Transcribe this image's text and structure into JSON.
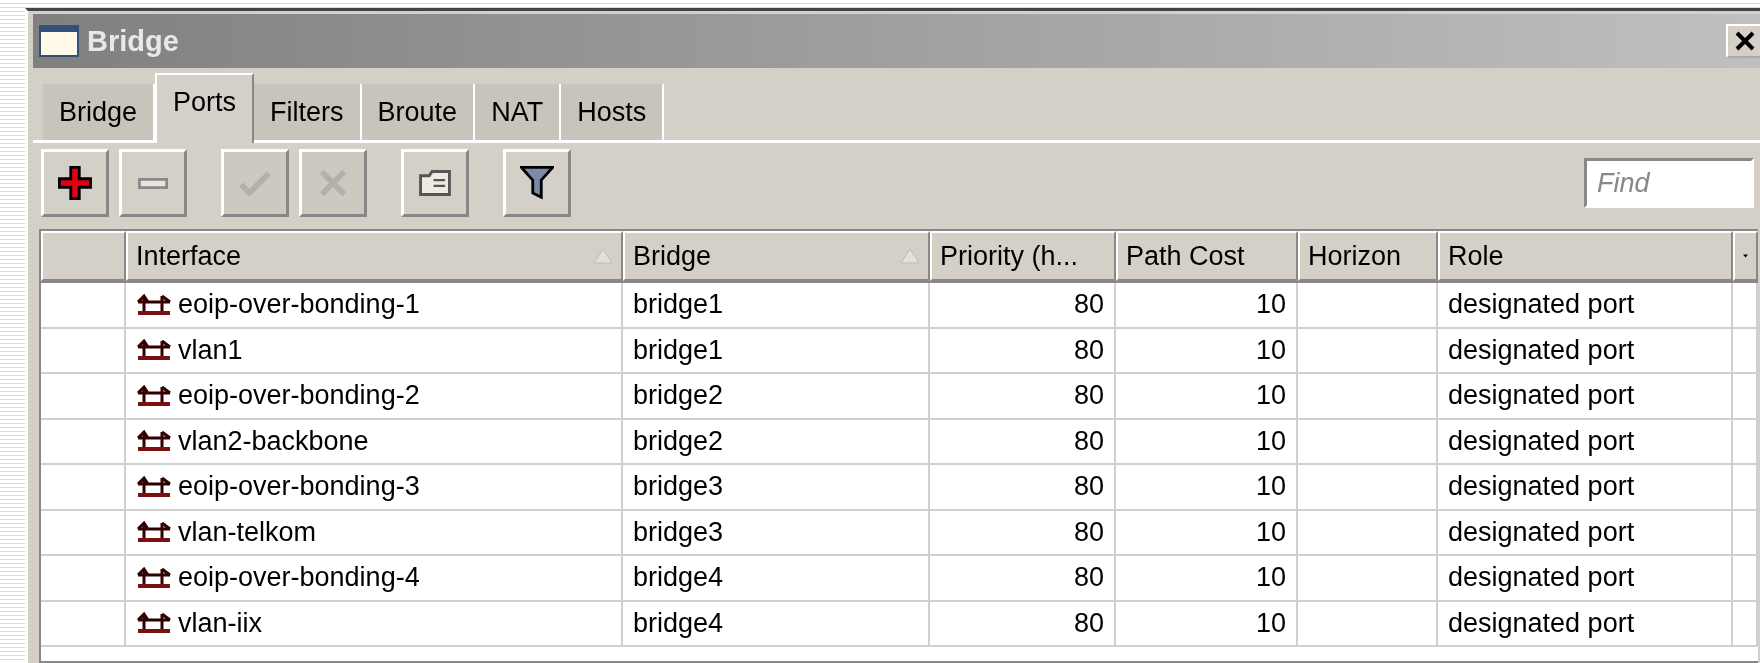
{
  "window": {
    "title": "Bridge"
  },
  "tabs": [
    {
      "label": "Bridge",
      "selected": false
    },
    {
      "label": "Ports",
      "selected": true
    },
    {
      "label": "Filters",
      "selected": false
    },
    {
      "label": "Broute",
      "selected": false
    },
    {
      "label": "NAT",
      "selected": false
    },
    {
      "label": "Hosts",
      "selected": false
    }
  ],
  "toolbar": [
    {
      "kind": "add",
      "disabled": false
    },
    {
      "kind": "remove",
      "disabled": false
    },
    {
      "kind": "enable",
      "disabled": true
    },
    {
      "kind": "disable",
      "disabled": true
    },
    {
      "kind": "comment",
      "disabled": false
    },
    {
      "kind": "filter",
      "disabled": false
    }
  ],
  "search": {
    "placeholder": "Find"
  },
  "table": {
    "columns": [
      {
        "label": "Interface",
        "sorted": true
      },
      {
        "label": "Bridge",
        "sorted": true
      },
      {
        "label": "Priority (h...",
        "sorted": false
      },
      {
        "label": "Path Cost",
        "sorted": false
      },
      {
        "label": "Horizon",
        "sorted": false
      },
      {
        "label": "Role",
        "sorted": false
      }
    ],
    "rows": [
      [
        "eoip-over-bonding-1",
        "bridge1",
        "80",
        "10",
        "",
        "designated port"
      ],
      [
        "vlan1",
        "bridge1",
        "80",
        "10",
        "",
        "designated port"
      ],
      [
        "eoip-over-bonding-2",
        "bridge2",
        "80",
        "10",
        "",
        "designated port"
      ],
      [
        "vlan2-backbone",
        "bridge2",
        "80",
        "10",
        "",
        "designated port"
      ],
      [
        "eoip-over-bonding-3",
        "bridge3",
        "80",
        "10",
        "",
        "designated port"
      ],
      [
        "vlan-telkom",
        "bridge3",
        "80",
        "10",
        "",
        "designated port"
      ],
      [
        "eoip-over-bonding-4",
        "bridge4",
        "80",
        "10",
        "",
        "designated port"
      ],
      [
        "vlan-iix",
        "bridge4",
        "80",
        "10",
        "",
        "designated port"
      ]
    ]
  }
}
